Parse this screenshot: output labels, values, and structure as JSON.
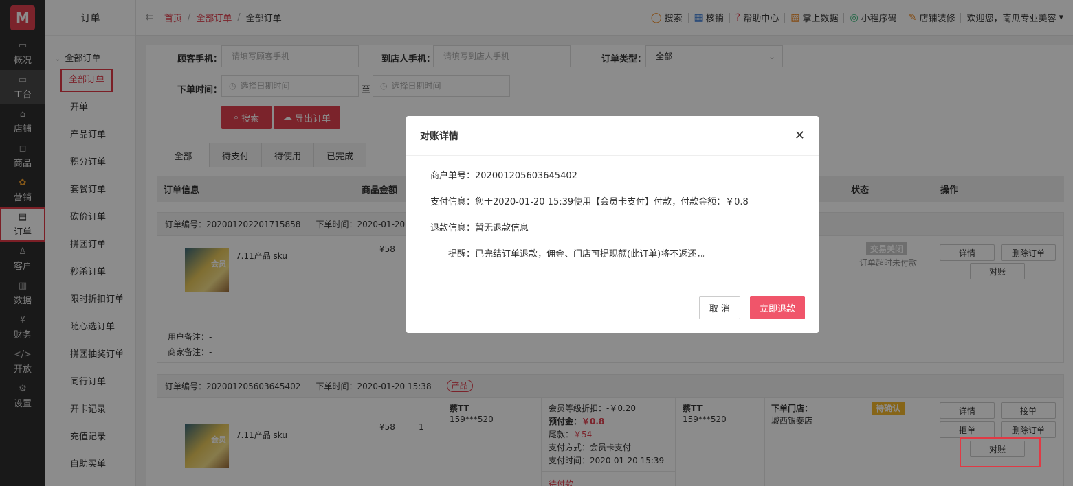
{
  "logo": "M",
  "rail": [
    {
      "label": "概况",
      "icon": "overview-icon",
      "glyph": "▭"
    },
    {
      "label": "工台",
      "icon": "desk-icon",
      "glyph": "▭"
    },
    {
      "label": "店铺",
      "icon": "store-icon",
      "glyph": "⌂"
    },
    {
      "label": "商品",
      "icon": "bag-icon",
      "glyph": "◻"
    },
    {
      "label": "营销",
      "icon": "marketing-icon",
      "glyph": "✿"
    },
    {
      "label": "订单",
      "icon": "order-icon",
      "glyph": "▤"
    },
    {
      "label": "客户",
      "icon": "customer-icon",
      "glyph": "♙"
    },
    {
      "label": "数据",
      "icon": "data-icon",
      "glyph": "▥"
    },
    {
      "label": "财务",
      "icon": "finance-icon",
      "glyph": "¥"
    },
    {
      "label": "开放",
      "icon": "code-icon",
      "glyph": "</>"
    },
    {
      "label": "设置",
      "icon": "settings-icon",
      "glyph": "⚙"
    }
  ],
  "sub": {
    "title": "订单",
    "group": "全部订单",
    "items": [
      "全部订单",
      "开单",
      "产品订单",
      "积分订单",
      "套餐订单",
      "砍价订单",
      "拼团订单",
      "秒杀订单",
      "限时折扣订单",
      "随心选订单",
      "拼团抽奖订单",
      "同行订单",
      "开卡记录",
      "充值记录",
      "自助买单"
    ]
  },
  "breadcrumb": {
    "home": "首页",
    "level2": "全部订单",
    "current": "全部订单"
  },
  "tools": [
    {
      "label": "搜索",
      "icon": "search-icon",
      "glyph": "◯",
      "color": "#f08a24"
    },
    {
      "label": "核销",
      "icon": "scan-icon",
      "glyph": "▦",
      "color": "#3b7dd8"
    },
    {
      "label": "帮助中心",
      "icon": "help-icon",
      "glyph": "?",
      "color": "#e0404f"
    },
    {
      "label": "掌上数据",
      "icon": "chart-icon",
      "glyph": "▨",
      "color": "#f08a24"
    },
    {
      "label": "小程序码",
      "icon": "miniapp-icon",
      "glyph": "◎",
      "color": "#2bb673"
    },
    {
      "label": "店铺装修",
      "icon": "brush-icon",
      "glyph": "✎",
      "color": "#f08a24"
    },
    {
      "label": "欢迎您，南瓜专业美容",
      "icon": "caret-down-icon",
      "glyph": "▾",
      "color": "#333"
    }
  ],
  "filters": {
    "customer_phone_label": "顾客手机：",
    "customer_phone_placeholder": "请填写顾客手机",
    "store_phone_label": "到店人手机：",
    "store_phone_placeholder": "请填写到店人手机",
    "order_type_label": "订单类型：",
    "order_type_value": "全部",
    "order_time_label": "下单时间：",
    "date_placeholder": "选择日期时间",
    "to": "至",
    "search_btn": "搜索",
    "export_btn": "导出订单"
  },
  "tabs": [
    "全部",
    "待支付",
    "待使用",
    "已完成"
  ],
  "table_head": {
    "info": "订单信息",
    "amount": "商品金额",
    "status": "状态",
    "ops": "操作"
  },
  "order1": {
    "no": "订单编号：202001202201715858",
    "time": "下单时间：2020-01-20 17",
    "product": "7.11产品 sku",
    "price": "¥58",
    "status": "交易关闭",
    "status_note": "订单超时未付款",
    "btn_detail": "详情",
    "btn_delete": "删除订单",
    "btn_reconcile": "对账",
    "user_note": "用户备注：-",
    "merchant_note": "商家备注：-"
  },
  "order2": {
    "no": "订单编号：202001205603645402",
    "time": "下单时间：2020-01-20 15:38",
    "tag": "产品",
    "product": "7.11产品 sku",
    "price": "¥58",
    "qty": "1",
    "buyer_name": "蔡TT",
    "buyer_phone": "159***520",
    "discount": "会员等级折扣：-￥0.20",
    "prepay_label": "预付金：",
    "prepay_value": "￥0.8",
    "balance_label": "尾款：",
    "balance_value": "￥54",
    "pay_method": "支付方式：会员卡支付",
    "pay_time": "支付时间：2020-01-20 15:39",
    "more": "待付款",
    "visitor_name": "蔡TT",
    "visitor_phone": "159***520",
    "store_label": "下单门店：",
    "store_value": "城西银泰店",
    "status": "待确认",
    "btn_detail": "详情",
    "btn_accept": "接单",
    "btn_reject": "拒单",
    "btn_delete": "删除订单",
    "btn_reconcile": "对账"
  },
  "modal": {
    "title": "对账详情",
    "merchant_no_label": "商户单号：",
    "merchant_no": "202001205603645402",
    "pay_info_label": "支付信息：",
    "pay_info": "您于2020-01-20 15:39使用【会员卡支付】付款，付款金额：￥0.8",
    "refund_label": "退款信息：",
    "refund_info": "暂无退款信息",
    "remind_label": "提醒：",
    "remind": "已完结订单退款，佣金、门店可提现额(此订单)将不返还，。",
    "cancel": "取 消",
    "confirm": "立即退款"
  }
}
